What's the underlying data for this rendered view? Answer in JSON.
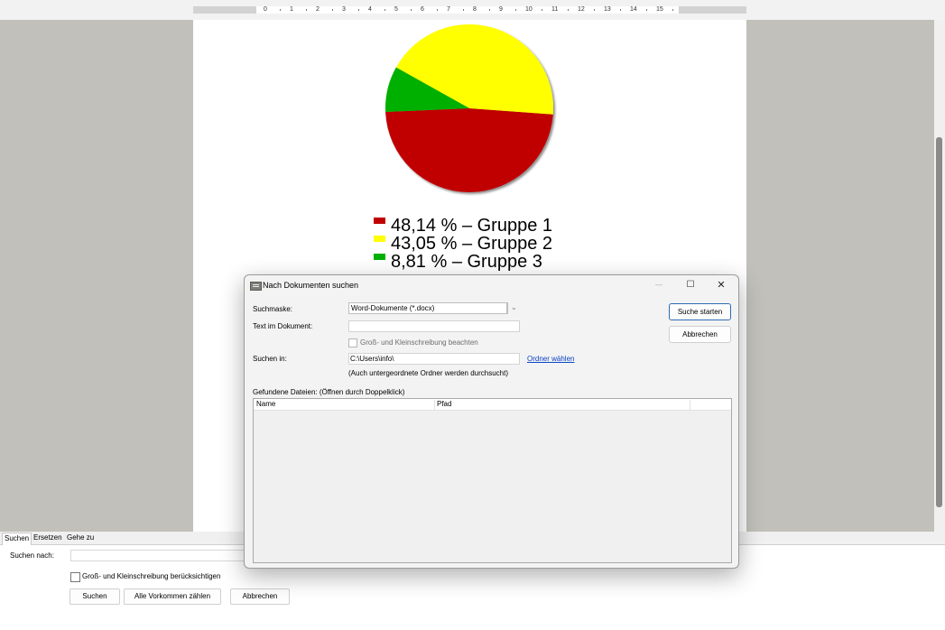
{
  "ruler": {
    "numbers": [
      "0",
      "1",
      "2",
      "3",
      "4",
      "5",
      "6",
      "7",
      "8",
      "9",
      "10",
      "11",
      "12",
      "13",
      "14",
      "15"
    ]
  },
  "document": {
    "chart_data": {
      "type": "pie",
      "title": "",
      "slices": [
        {
          "label": "48,14 % – Gruppe 1",
          "value": 48.14,
          "color": "#c00000"
        },
        {
          "label": "43,05 % – Gruppe 2",
          "value": 43.05,
          "color": "#ffff00"
        },
        {
          "label": "8,81 % – Gruppe 3",
          "value": 8.81,
          "color": "#00b000"
        }
      ],
      "legend": "below"
    }
  },
  "dialog": {
    "title": "Nach Dokumenten suchen",
    "window_buttons": {
      "minimize": "—",
      "maximize": "☐",
      "close": "✕"
    },
    "mask_label": "Suchmaske:",
    "mask_value": "Word-Dokumente (*.docx)",
    "text_label": "Text im Dokument:",
    "text_value": "",
    "case_label": "Groß- und Kleinschreibung beachten",
    "folder_label": "Suchen in:",
    "folder_value": "C:\\Users\\info\\",
    "choose_folder_link": "Ordner wählen",
    "subfolder_note": "(Auch untergeordnete Ordner werden durchsucht)",
    "start_button": "Suche starten",
    "cancel_button": "Abbrechen",
    "results_label": "Gefundene Dateien: (Öffnen durch Doppelklick)",
    "columns": [
      "Name",
      "Pfad"
    ]
  },
  "find_panel": {
    "tabs": [
      "Suchen",
      "Ersetzen",
      "Gehe zu"
    ],
    "active_tab": "Suchen",
    "search_label": "Suchen nach:",
    "search_value": "",
    "case_label": "Groß- und Kleinschreibung berücksichtigen",
    "buttons": {
      "search": "Suchen",
      "count_all": "Alle Vorkommen zählen",
      "cancel": "Abbrechen"
    }
  },
  "colors": {
    "workspace": "#c1c0bb",
    "link": "#0a44c7"
  }
}
